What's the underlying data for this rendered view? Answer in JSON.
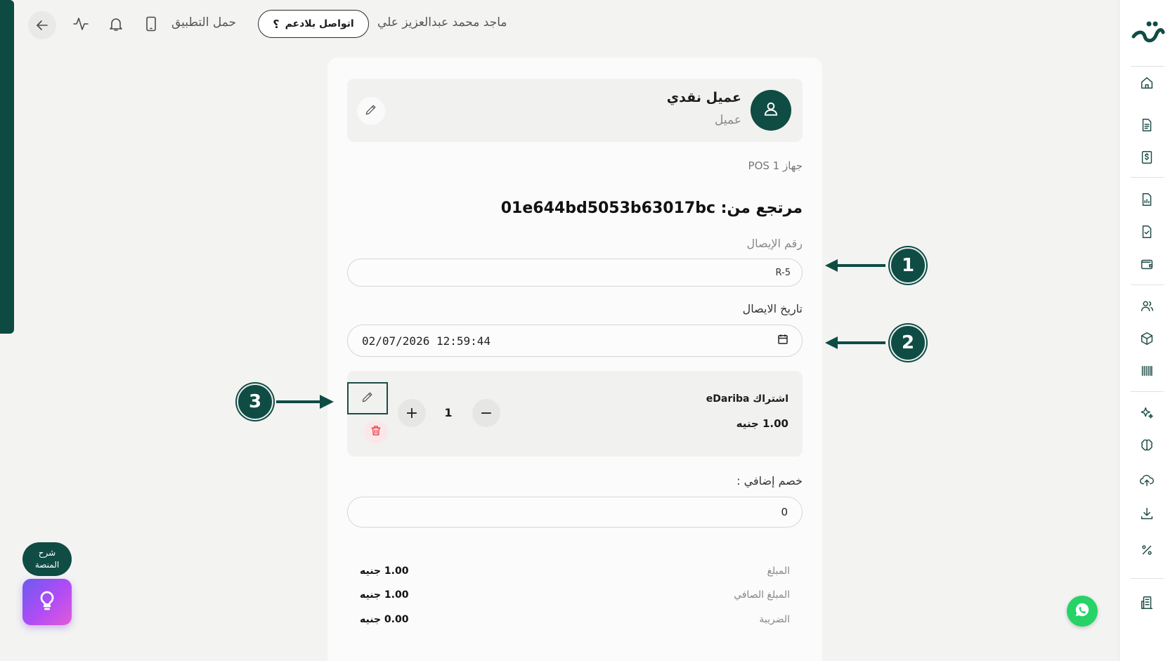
{
  "topbar": {
    "user_name": "ماجد محمد عبدالعزيز علي",
    "support_label": "اتواصل بلادعم",
    "support_icon_glyph": "؟",
    "app_download_label": "حمل التطبيق"
  },
  "customer": {
    "name": "عميل نقدي",
    "role": "عميل"
  },
  "device_label": "جهاز POS 1",
  "return_from": "مرتجع من: 01e644bd5053b63017bc",
  "receipt": {
    "label": "رقم الإيصال",
    "value": "R-5"
  },
  "receipt_date": {
    "label": "تاريخ الايصال",
    "value": "02/07/2026 12:59:44"
  },
  "item": {
    "title": "اشتراك eDariba",
    "price": "1.00 جنيه",
    "quantity": "1",
    "plus": "+",
    "minus": "−"
  },
  "discount": {
    "label": "خصم إضافي :",
    "value": "0"
  },
  "summary": [
    {
      "label": "المبلغ",
      "value": "1.00 جنيه"
    },
    {
      "label": "المبلغ الصافي",
      "value": "1.00 جنيه"
    },
    {
      "label": "الضريبة",
      "value": "0.00 جنيه"
    }
  ],
  "markers": [
    "1",
    "2",
    "3"
  ],
  "help": {
    "line1": "شرح",
    "line2": "المنصة"
  },
  "colors": {
    "brand": "#0f4c44",
    "background": "#f3f3f2",
    "danger": "#e0303a"
  },
  "icons": {
    "sidebar": [
      "home-icon",
      "document-icon",
      "invoice-dollar-icon",
      "report-chart-icon",
      "document-check-icon",
      "wallet-icon",
      "users-icon",
      "box-icon",
      "barcode-icon",
      "sparkles-icon",
      "brain-icon",
      "cloud-upload-icon",
      "download-icon",
      "percent-icon",
      "building-icon"
    ],
    "topbar": [
      "back-arrow-icon",
      "activity-icon",
      "bell-icon",
      "mobile-icon"
    ]
  }
}
